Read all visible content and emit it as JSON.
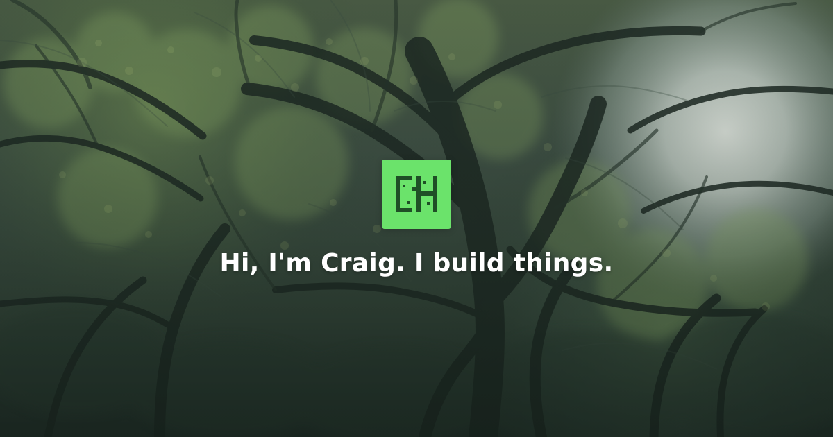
{
  "hero": {
    "headline": "Hi, I'm Craig. I build things.",
    "logo_text": "CH",
    "background_image_subject": "forest canopy with sunlight",
    "colors": {
      "logo_bg": "#6be36b",
      "logo_mark": "#1f4f26",
      "headline": "#ffffff",
      "background_tint": "#33443b"
    },
    "icons": {
      "logo": "ch-logo-icon"
    }
  }
}
